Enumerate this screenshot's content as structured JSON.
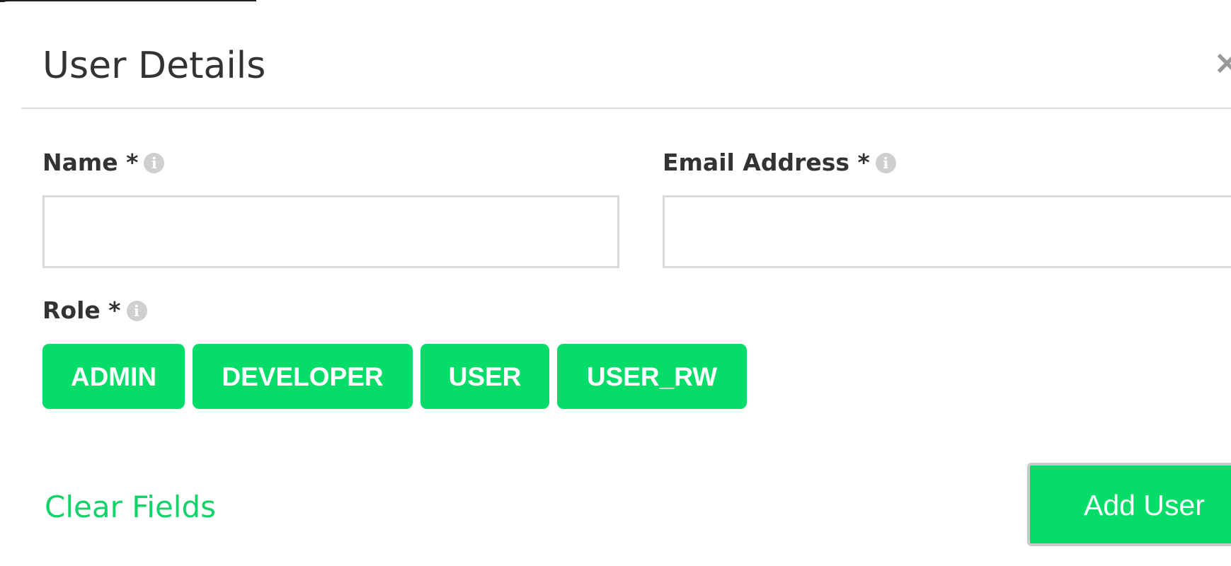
{
  "modal": {
    "title": "User Details",
    "close_glyph": "×"
  },
  "form": {
    "name": {
      "label": "Name *",
      "value": "",
      "info_icon": "info-icon"
    },
    "email": {
      "label": "Email Address *",
      "value": "",
      "info_icon": "info-icon"
    },
    "role": {
      "label": "Role *",
      "info_icon": "info-icon",
      "options": [
        "ADMIN",
        "DEVELOPER",
        "USER",
        "USER_RW"
      ]
    }
  },
  "actions": {
    "clear_label": "Clear Fields",
    "submit_label": "Add User"
  },
  "colors": {
    "accent": "#05dd68",
    "link": "#12d36a",
    "text": "#333333",
    "border": "#d9d9d9",
    "info_icon": "#cfcfcf"
  }
}
